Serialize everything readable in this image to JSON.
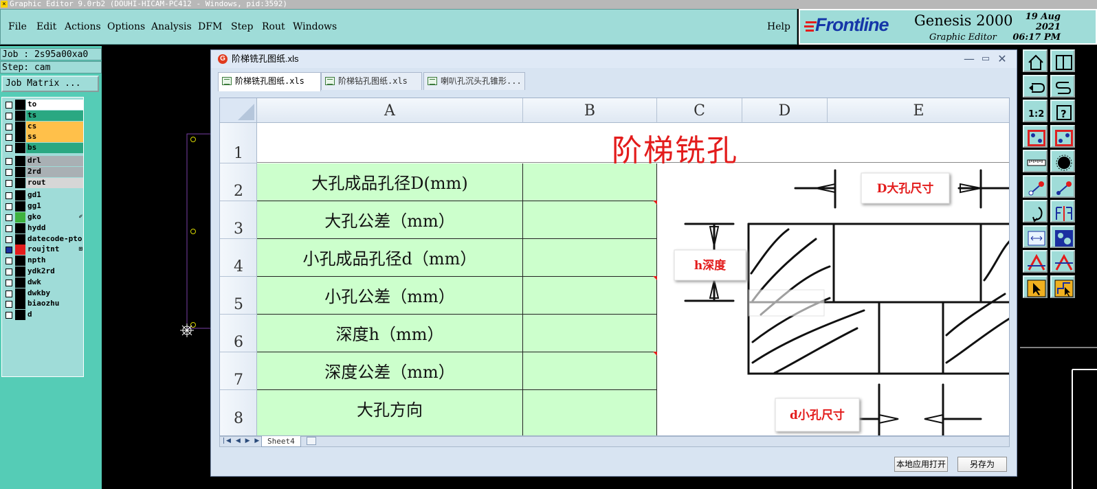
{
  "window": {
    "title": "Graphic Editor 9.0rb2 (DOUHI-HICAM-PC412 - Windows, pid:3592)"
  },
  "menu": {
    "items": [
      "File",
      "Edit",
      "Actions",
      "Options",
      "Analysis",
      "DFM",
      "Step",
      "Rout",
      "Windows"
    ],
    "help": "Help"
  },
  "brand": {
    "logo": "Frontline",
    "app_name": "Genesis 2000",
    "app_sub": "Graphic Editor",
    "date": "19 Aug 2021",
    "time": "06:17 PM"
  },
  "job": {
    "job_label": "Job : 2s95a00xa0",
    "step_label": "Step: cam",
    "matrix_button": "Job Matrix ..."
  },
  "layers": [
    {
      "name": "to",
      "color": "#ffffff"
    },
    {
      "name": "ts",
      "color": "#2aa882"
    },
    {
      "name": "cs",
      "color": "#ffc04a"
    },
    {
      "name": "ss",
      "color": "#ffc04a"
    },
    {
      "name": "bs",
      "color": "#2aa882"
    },
    {
      "name": "drl",
      "color": "#a9b0b4"
    },
    {
      "name": "2rd",
      "color": "#a9b0b4"
    },
    {
      "name": "rout",
      "color": "#d6d6d6"
    },
    {
      "name": "gd1",
      "color": "#9fdcd8"
    },
    {
      "name": "gg1",
      "color": "#9fdcd8"
    },
    {
      "name": "gko",
      "color": "#9fdcd8",
      "swatch": "#3fb23f",
      "ext": "✐"
    },
    {
      "name": "hydd",
      "color": "#9fdcd8"
    },
    {
      "name": "datecode-pto",
      "color": "#9fdcd8"
    },
    {
      "name": "roujtnt",
      "color": "#9fdcd8",
      "swatch": "#e31c1c",
      "ext": "⊞",
      "cb": "#1a2fa0"
    },
    {
      "name": "npth",
      "color": "#9fdcd8"
    },
    {
      "name": "ydk2rd",
      "color": "#9fdcd8"
    },
    {
      "name": "dwk",
      "color": "#9fdcd8"
    },
    {
      "name": "dwkby",
      "color": "#9fdcd8"
    },
    {
      "name": "biaozhu",
      "color": "#9fdcd8"
    },
    {
      "name": "d",
      "color": "#9fdcd8"
    }
  ],
  "dialog": {
    "title": "阶梯铣孔图纸.xls",
    "tabs": [
      "阶梯铣孔图纸.xls",
      "阶梯钻孔图纸.xls",
      "喇叭孔沉头孔锥形..."
    ],
    "open_local_button": "本地应用打开",
    "save_as_button": "另存为"
  },
  "sheet": {
    "columns": [
      "A",
      "B",
      "C",
      "D",
      "E"
    ],
    "rows": [
      "1",
      "2",
      "3",
      "4",
      "5",
      "6",
      "7",
      "8"
    ],
    "title": "阶梯铣孔",
    "labels": [
      "大孔成品孔径D(mm)",
      "大孔公差（mm）",
      "小孔成品孔径d（mm）",
      "小孔公差（mm）",
      "深度h（mm）",
      "深度公差（mm）",
      "大孔方向"
    ],
    "sheet_tab": "Sheet4",
    "diagram_labels": {
      "big": "D大孔尺寸",
      "depth": "h深度",
      "small": "d小孔尺寸"
    }
  }
}
